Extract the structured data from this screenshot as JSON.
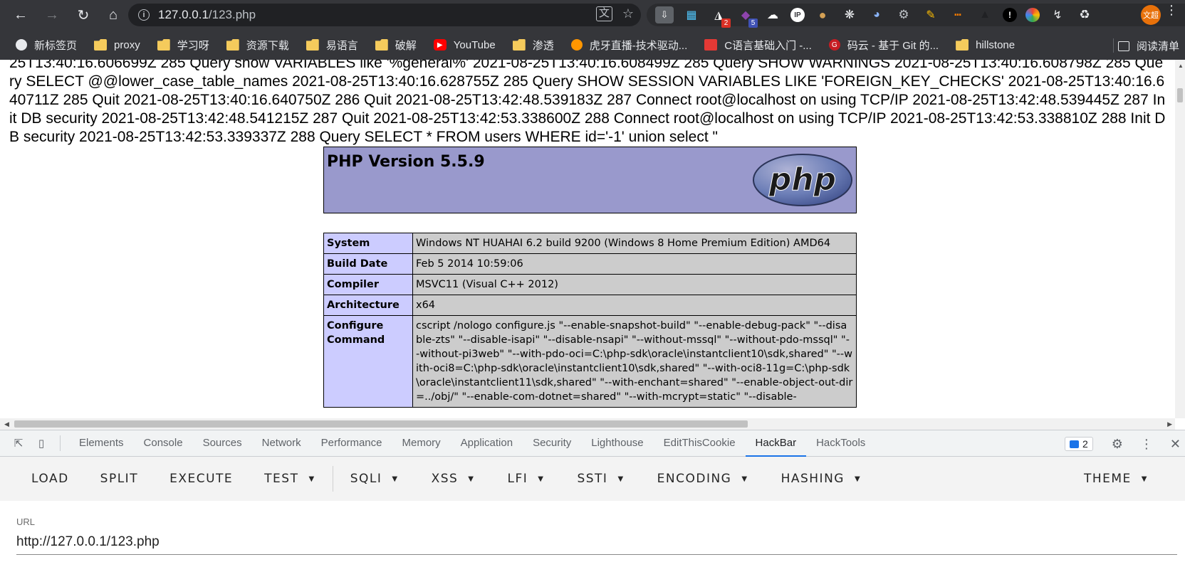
{
  "browser": {
    "url_host": "127.0.0.1",
    "url_path": "/123.php",
    "extension_badges": {
      "ext3": "2",
      "ext4": "5"
    },
    "profile_name": "文超"
  },
  "bookmarks": {
    "items": [
      {
        "label": "新标签页",
        "icon": "globe-icon"
      },
      {
        "label": "proxy",
        "icon": "folder-icon"
      },
      {
        "label": "学习呀",
        "icon": "folder-icon"
      },
      {
        "label": "资源下载",
        "icon": "folder-icon"
      },
      {
        "label": "易语言",
        "icon": "folder-icon"
      },
      {
        "label": "破解",
        "icon": "folder-icon"
      },
      {
        "label": "YouTube",
        "icon": "youtube-icon"
      },
      {
        "label": "渗透",
        "icon": "folder-icon"
      },
      {
        "label": "虎牙直播-技术驱动...",
        "icon": "huya-icon"
      },
      {
        "label": "C语言基础入门 -...",
        "icon": "red-book-icon"
      },
      {
        "label": "码云 - 基于 Git 的...",
        "icon": "gitee-icon"
      },
      {
        "label": "hillstone",
        "icon": "folder-icon"
      }
    ],
    "reading_list": "阅读清单"
  },
  "page": {
    "log_text": "25T13:40:16.606699Z 285 Query show VARIABLES like '%general%' 2021-08-25T13:40:16.608499Z 285 Query SHOW WARNINGS 2021-08-25T13:40:16.608798Z 285 Query SELECT @@lower_case_table_names 2021-08-25T13:40:16.628755Z 285 Query SHOW SESSION VARIABLES LIKE 'FOREIGN_KEY_CHECKS' 2021-08-25T13:40:16.640711Z 285 Quit 2021-08-25T13:40:16.640750Z 286 Quit 2021-08-25T13:42:48.539183Z 287 Connect root@localhost on using TCP/IP 2021-08-25T13:42:48.539445Z 287 Init DB security 2021-08-25T13:42:48.541215Z 287 Quit 2021-08-25T13:42:53.338600Z 288 Connect root@localhost on using TCP/IP 2021-08-25T13:42:53.338810Z 288 Init DB security 2021-08-25T13:42:53.339337Z 288 Query SELECT * FROM users WHERE id='-1' union select \"",
    "php_version": "PHP Version 5.5.9",
    "php_logo_text": "php",
    "rows": [
      {
        "key": "System",
        "value": "Windows NT HUAHAI 6.2 build 9200 (Windows 8 Home Premium Edition) AMD64"
      },
      {
        "key": "Build Date",
        "value": "Feb 5 2014 10:59:06"
      },
      {
        "key": "Compiler",
        "value": "MSVC11 (Visual C++ 2012)"
      },
      {
        "key": "Architecture",
        "value": "x64"
      },
      {
        "key": "Configure Command",
        "value": "cscript /nologo configure.js \"--enable-snapshot-build\" \"--enable-debug-pack\" \"--disable-zts\" \"--disable-isapi\" \"--disable-nsapi\" \"--without-mssql\" \"--without-pdo-mssql\" \"--without-pi3web\" \"--with-pdo-oci=C:\\php-sdk\\oracle\\instantclient10\\sdk,shared\" \"--with-oci8=C:\\php-sdk\\oracle\\instantclient10\\sdk,shared\" \"--with-oci8-11g=C:\\php-sdk\\oracle\\instantclient11\\sdk,shared\" \"--with-enchant=shared\" \"--enable-object-out-dir=../obj/\" \"--enable-com-dotnet=shared\" \"--with-mcrypt=static\" \"--disable-"
      }
    ]
  },
  "devtools": {
    "tabs": [
      "Elements",
      "Console",
      "Sources",
      "Network",
      "Performance",
      "Memory",
      "Application",
      "Security",
      "Lighthouse",
      "EditThisCookie",
      "HackBar",
      "HackTools"
    ],
    "active_tab": "HackBar",
    "issues_count": "2"
  },
  "hackbar": {
    "buttons": [
      {
        "label": "LOAD",
        "dropdown": false
      },
      {
        "label": "SPLIT",
        "dropdown": false
      },
      {
        "label": "EXECUTE",
        "dropdown": false
      },
      {
        "label": "TEST",
        "dropdown": true
      }
    ],
    "menus": [
      {
        "label": "SQLI",
        "dropdown": true
      },
      {
        "label": "XSS",
        "dropdown": true
      },
      {
        "label": "LFI",
        "dropdown": true
      },
      {
        "label": "SSTI",
        "dropdown": true
      },
      {
        "label": "ENCODING",
        "dropdown": true
      },
      {
        "label": "HASHING",
        "dropdown": true
      }
    ],
    "theme_label": "THEME",
    "url_label": "URL",
    "url_value": "http://127.0.0.1/123.php"
  }
}
